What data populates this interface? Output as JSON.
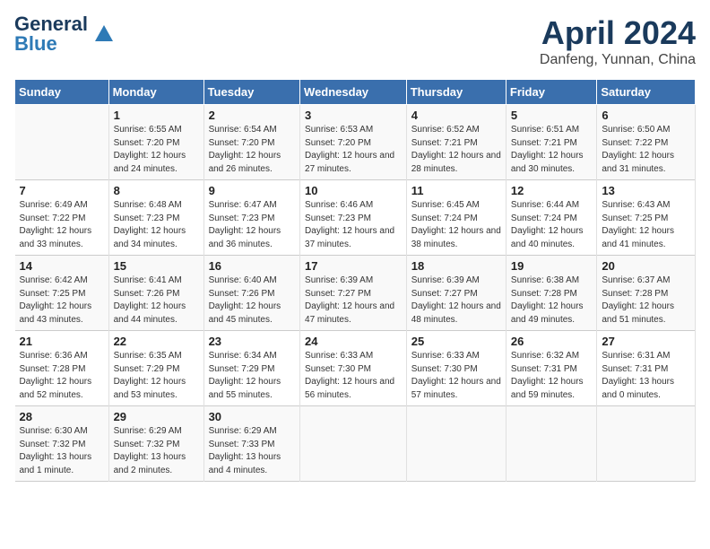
{
  "logo": {
    "general": "General",
    "blue": "Blue"
  },
  "title": "April 2024",
  "location": "Danfeng, Yunnan, China",
  "days_of_week": [
    "Sunday",
    "Monday",
    "Tuesday",
    "Wednesday",
    "Thursday",
    "Friday",
    "Saturday"
  ],
  "weeks": [
    [
      {
        "day": "",
        "sunrise": "",
        "sunset": "",
        "daylight": ""
      },
      {
        "day": "1",
        "sunrise": "Sunrise: 6:55 AM",
        "sunset": "Sunset: 7:20 PM",
        "daylight": "Daylight: 12 hours and 24 minutes."
      },
      {
        "day": "2",
        "sunrise": "Sunrise: 6:54 AM",
        "sunset": "Sunset: 7:20 PM",
        "daylight": "Daylight: 12 hours and 26 minutes."
      },
      {
        "day": "3",
        "sunrise": "Sunrise: 6:53 AM",
        "sunset": "Sunset: 7:20 PM",
        "daylight": "Daylight: 12 hours and 27 minutes."
      },
      {
        "day": "4",
        "sunrise": "Sunrise: 6:52 AM",
        "sunset": "Sunset: 7:21 PM",
        "daylight": "Daylight: 12 hours and 28 minutes."
      },
      {
        "day": "5",
        "sunrise": "Sunrise: 6:51 AM",
        "sunset": "Sunset: 7:21 PM",
        "daylight": "Daylight: 12 hours and 30 minutes."
      },
      {
        "day": "6",
        "sunrise": "Sunrise: 6:50 AM",
        "sunset": "Sunset: 7:22 PM",
        "daylight": "Daylight: 12 hours and 31 minutes."
      }
    ],
    [
      {
        "day": "7",
        "sunrise": "Sunrise: 6:49 AM",
        "sunset": "Sunset: 7:22 PM",
        "daylight": "Daylight: 12 hours and 33 minutes."
      },
      {
        "day": "8",
        "sunrise": "Sunrise: 6:48 AM",
        "sunset": "Sunset: 7:23 PM",
        "daylight": "Daylight: 12 hours and 34 minutes."
      },
      {
        "day": "9",
        "sunrise": "Sunrise: 6:47 AM",
        "sunset": "Sunset: 7:23 PM",
        "daylight": "Daylight: 12 hours and 36 minutes."
      },
      {
        "day": "10",
        "sunrise": "Sunrise: 6:46 AM",
        "sunset": "Sunset: 7:23 PM",
        "daylight": "Daylight: 12 hours and 37 minutes."
      },
      {
        "day": "11",
        "sunrise": "Sunrise: 6:45 AM",
        "sunset": "Sunset: 7:24 PM",
        "daylight": "Daylight: 12 hours and 38 minutes."
      },
      {
        "day": "12",
        "sunrise": "Sunrise: 6:44 AM",
        "sunset": "Sunset: 7:24 PM",
        "daylight": "Daylight: 12 hours and 40 minutes."
      },
      {
        "day": "13",
        "sunrise": "Sunrise: 6:43 AM",
        "sunset": "Sunset: 7:25 PM",
        "daylight": "Daylight: 12 hours and 41 minutes."
      }
    ],
    [
      {
        "day": "14",
        "sunrise": "Sunrise: 6:42 AM",
        "sunset": "Sunset: 7:25 PM",
        "daylight": "Daylight: 12 hours and 43 minutes."
      },
      {
        "day": "15",
        "sunrise": "Sunrise: 6:41 AM",
        "sunset": "Sunset: 7:26 PM",
        "daylight": "Daylight: 12 hours and 44 minutes."
      },
      {
        "day": "16",
        "sunrise": "Sunrise: 6:40 AM",
        "sunset": "Sunset: 7:26 PM",
        "daylight": "Daylight: 12 hours and 45 minutes."
      },
      {
        "day": "17",
        "sunrise": "Sunrise: 6:39 AM",
        "sunset": "Sunset: 7:27 PM",
        "daylight": "Daylight: 12 hours and 47 minutes."
      },
      {
        "day": "18",
        "sunrise": "Sunrise: 6:39 AM",
        "sunset": "Sunset: 7:27 PM",
        "daylight": "Daylight: 12 hours and 48 minutes."
      },
      {
        "day": "19",
        "sunrise": "Sunrise: 6:38 AM",
        "sunset": "Sunset: 7:28 PM",
        "daylight": "Daylight: 12 hours and 49 minutes."
      },
      {
        "day": "20",
        "sunrise": "Sunrise: 6:37 AM",
        "sunset": "Sunset: 7:28 PM",
        "daylight": "Daylight: 12 hours and 51 minutes."
      }
    ],
    [
      {
        "day": "21",
        "sunrise": "Sunrise: 6:36 AM",
        "sunset": "Sunset: 7:28 PM",
        "daylight": "Daylight: 12 hours and 52 minutes."
      },
      {
        "day": "22",
        "sunrise": "Sunrise: 6:35 AM",
        "sunset": "Sunset: 7:29 PM",
        "daylight": "Daylight: 12 hours and 53 minutes."
      },
      {
        "day": "23",
        "sunrise": "Sunrise: 6:34 AM",
        "sunset": "Sunset: 7:29 PM",
        "daylight": "Daylight: 12 hours and 55 minutes."
      },
      {
        "day": "24",
        "sunrise": "Sunrise: 6:33 AM",
        "sunset": "Sunset: 7:30 PM",
        "daylight": "Daylight: 12 hours and 56 minutes."
      },
      {
        "day": "25",
        "sunrise": "Sunrise: 6:33 AM",
        "sunset": "Sunset: 7:30 PM",
        "daylight": "Daylight: 12 hours and 57 minutes."
      },
      {
        "day": "26",
        "sunrise": "Sunrise: 6:32 AM",
        "sunset": "Sunset: 7:31 PM",
        "daylight": "Daylight: 12 hours and 59 minutes."
      },
      {
        "day": "27",
        "sunrise": "Sunrise: 6:31 AM",
        "sunset": "Sunset: 7:31 PM",
        "daylight": "Daylight: 13 hours and 0 minutes."
      }
    ],
    [
      {
        "day": "28",
        "sunrise": "Sunrise: 6:30 AM",
        "sunset": "Sunset: 7:32 PM",
        "daylight": "Daylight: 13 hours and 1 minute."
      },
      {
        "day": "29",
        "sunrise": "Sunrise: 6:29 AM",
        "sunset": "Sunset: 7:32 PM",
        "daylight": "Daylight: 13 hours and 2 minutes."
      },
      {
        "day": "30",
        "sunrise": "Sunrise: 6:29 AM",
        "sunset": "Sunset: 7:33 PM",
        "daylight": "Daylight: 13 hours and 4 minutes."
      },
      {
        "day": "",
        "sunrise": "",
        "sunset": "",
        "daylight": ""
      },
      {
        "day": "",
        "sunrise": "",
        "sunset": "",
        "daylight": ""
      },
      {
        "day": "",
        "sunrise": "",
        "sunset": "",
        "daylight": ""
      },
      {
        "day": "",
        "sunrise": "",
        "sunset": "",
        "daylight": ""
      }
    ]
  ]
}
